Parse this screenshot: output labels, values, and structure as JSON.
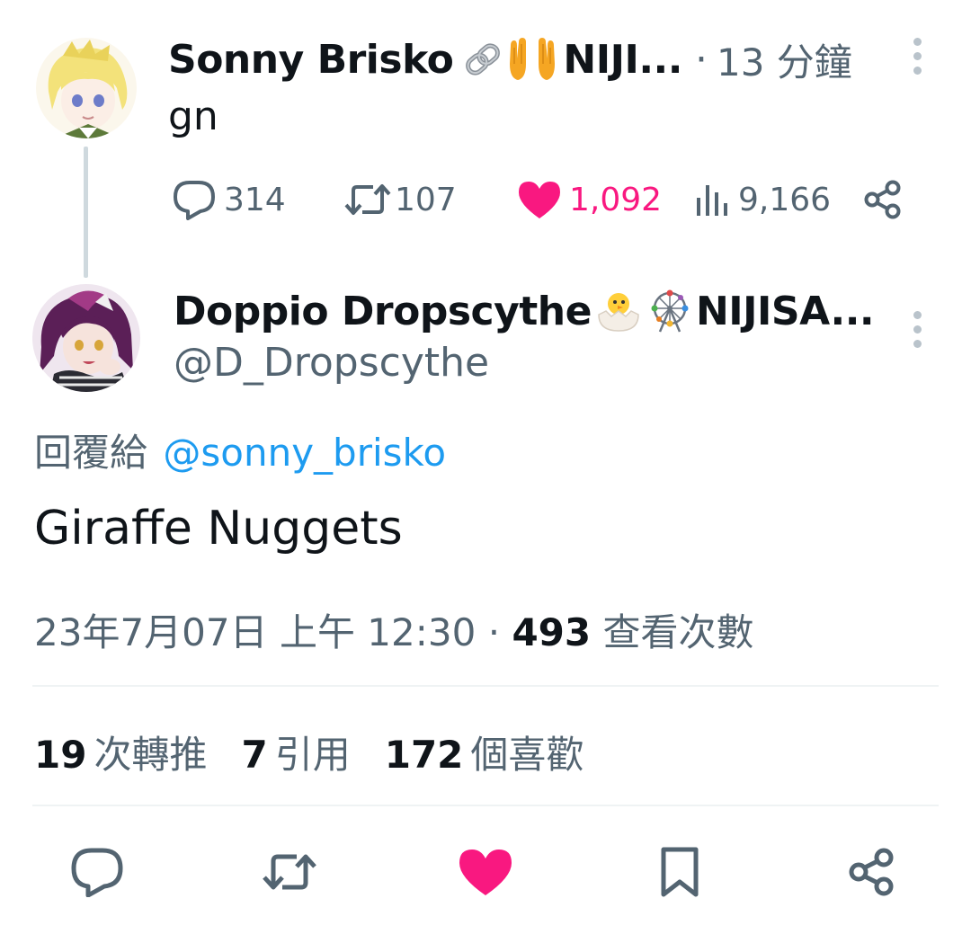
{
  "parent_tweet": {
    "display_name": "Sonny Brisko",
    "display_name_tail": "NIJI...",
    "name_emojis": [
      "link-emoji",
      "palms-up-emoji"
    ],
    "separator": "·",
    "time_ago": "13 分鐘",
    "text": "gn",
    "actions": {
      "replies": "314",
      "retweets": "107",
      "likes": "1,092",
      "views": "9,166"
    }
  },
  "main_tweet": {
    "display_name": "Doppio Dropscythe",
    "display_name_tail": "NIJISA...",
    "name_emojis": [
      "hatching-chick-emoji",
      "ferris-wheel-emoji"
    ],
    "handle": "@D_Dropscythe",
    "reply_prefix": "回覆給",
    "reply_mention": "@sonny_brisko",
    "text": "Giraffe Nuggets",
    "timestamp": "23年7月07日 上午 12:30",
    "separator": "·",
    "view_count": "493",
    "view_label": "查看次數",
    "stats": {
      "retweets_count": "19",
      "retweets_label": "次轉推",
      "quotes_count": "7",
      "quotes_label": "引用",
      "likes_count": "172",
      "likes_label": "個喜歡"
    }
  },
  "colors": {
    "text_primary": "#0f1419",
    "text_secondary": "#536471",
    "link": "#1d9bf0",
    "like": "#f91880",
    "divider": "#eff3f4",
    "thread_line": "#cfd9de"
  }
}
